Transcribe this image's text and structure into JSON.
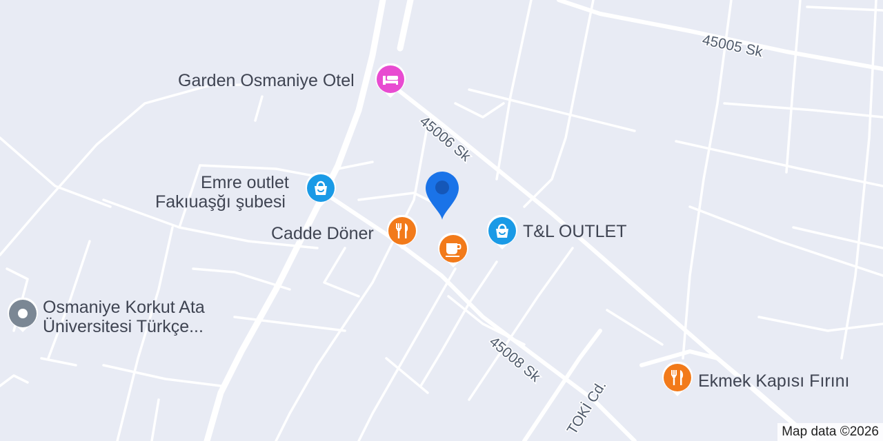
{
  "map": {
    "background_color": "#e8ebf4",
    "road_color": "#ffffff",
    "attribution": "Map data ©2026",
    "streets": [
      {
        "name": "45005 Sk"
      },
      {
        "name": "45006 Sk"
      },
      {
        "name": "45008 Sk"
      },
      {
        "name": "TOKİ Cd."
      }
    ],
    "pois": [
      {
        "name": "Garden Osmaniye Otel",
        "category": "hotel",
        "icon": "bed-icon",
        "color": "#e84bd1"
      },
      {
        "line1": "Emre outlet",
        "line2": "Fakıuaşğı şubesi",
        "category": "shopping",
        "icon": "shopping-bag-icon",
        "color": "#1a9ae6"
      },
      {
        "name": "T&L OUTLET",
        "category": "shopping",
        "icon": "shopping-bag-icon",
        "color": "#1a9ae6"
      },
      {
        "name": "Cadde Döner",
        "category": "restaurant",
        "icon": "fork-knife-icon",
        "color": "#f27a1a"
      },
      {
        "name": "",
        "category": "cafe",
        "icon": "coffee-cup-icon",
        "color": "#f27a1a"
      },
      {
        "line1": "Osmaniye Korkut Ata",
        "line2": "Üniversitesi Türkçe...",
        "category": "place",
        "icon": "place-marker-icon",
        "color": "#7b8794"
      },
      {
        "name": "Ekmek Kapısı Fırını",
        "category": "restaurant",
        "icon": "fork-knife-icon",
        "color": "#f27a1a"
      }
    ],
    "location_marker": {
      "icon": "location-pin-icon",
      "color": "#1a73e8"
    }
  }
}
